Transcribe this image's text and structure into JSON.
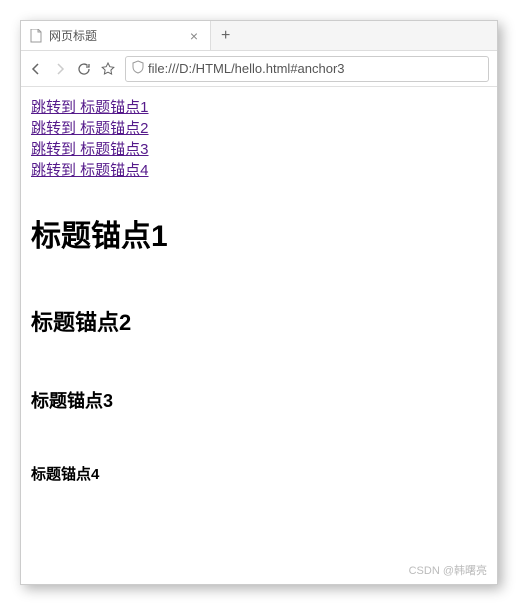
{
  "tab": {
    "title": "网页标题"
  },
  "url": "file:///D:/HTML/hello.html#anchor3",
  "links": [
    "跳转到 标题锚点1",
    "跳转到 标题锚点2",
    "跳转到 标题锚点3",
    "跳转到 标题锚点4"
  ],
  "headings": {
    "h1": "标题锚点1",
    "h2": "标题锚点2",
    "h3": "标题锚点3",
    "h4": "标题锚点4"
  },
  "watermark": "CSDN @韩曙亮"
}
